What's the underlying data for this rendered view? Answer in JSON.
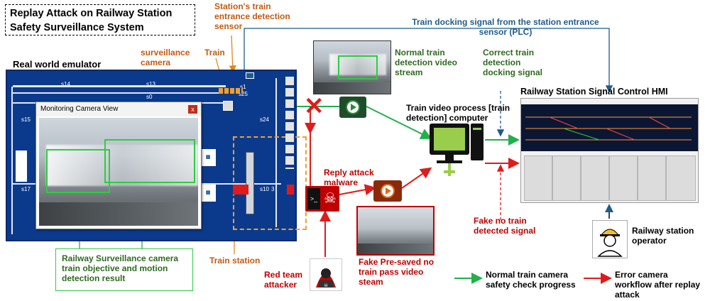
{
  "title": "Replay Attack on Railway Station Safety Surveillance System",
  "labels": {
    "entrance_sensor": "Station's train entrance detection sensor",
    "surveillance_camera": "surveillance camera",
    "train": "Train",
    "real_world_emulator": "Real world emulator",
    "docking_signal_plc": "Train docking signal from the station entrance sensor (PLC)",
    "normal_stream": "Normal train detection video stream",
    "correct_signal": "Correct train detection docking signal",
    "hmi_title": "Railway Station Signal Control HMI",
    "video_process": "Train video process [train detection] computer",
    "replay_malware": "Reply attack malware",
    "fake_signal": "Fake no train detected signal",
    "operator": "Railway station operator",
    "surveillance_result": "Railway Surveillance camera  train objective and motion detection result",
    "train_station": "Train station",
    "red_team": "Red team attacker",
    "fake_stream": "Fake Pre-saved no train pass video steam",
    "legend_normal": "Normal train camera safety check progress",
    "legend_error": "Error camera workflow after replay attack"
  },
  "monitor_window": {
    "title": "Monitoring Camera View",
    "close": "x"
  },
  "track_labels": [
    "s14",
    "s13",
    "s0",
    "s25",
    "s15",
    "s17",
    "s24",
    "s10",
    "3",
    "s1"
  ],
  "colors": {
    "normal_flow": "#22b04b",
    "error_flow": "#e01b1b",
    "plc_line": "#1f5c8b",
    "orange_label": "#c55a11"
  },
  "icons": {
    "blocked": "red-x-icon",
    "video": "video-play-icon",
    "malware": "skull-terminal-icon",
    "computer": "desktop-computer-icon",
    "attacker": "hacker-icon",
    "operator": "worker-helmet-icon"
  }
}
